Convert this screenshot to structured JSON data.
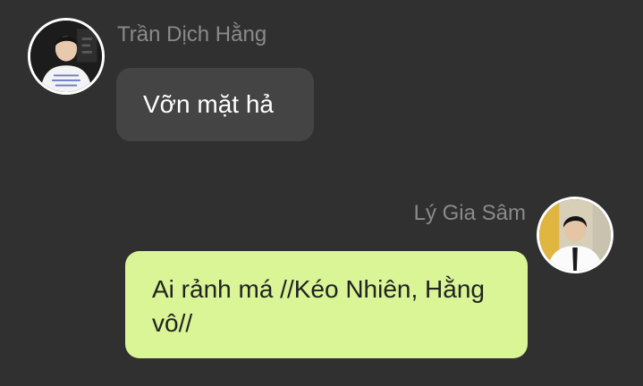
{
  "colors": {
    "background": "#303030",
    "incoming_bubble": "#444444",
    "outgoing_bubble": "#d9f596",
    "sender_name": "#8a8a8a"
  },
  "messages": [
    {
      "sender": "Trần Dịch Hằng",
      "text": "Vỡn mặt hả",
      "direction": "incoming",
      "avatar_icon": "user-avatar-icon"
    },
    {
      "sender": "Lý Gia Sâm",
      "text": "Ai rảnh má //Kéo Nhiên, Hằng vô//",
      "direction": "outgoing",
      "avatar_icon": "user-avatar-icon"
    }
  ]
}
